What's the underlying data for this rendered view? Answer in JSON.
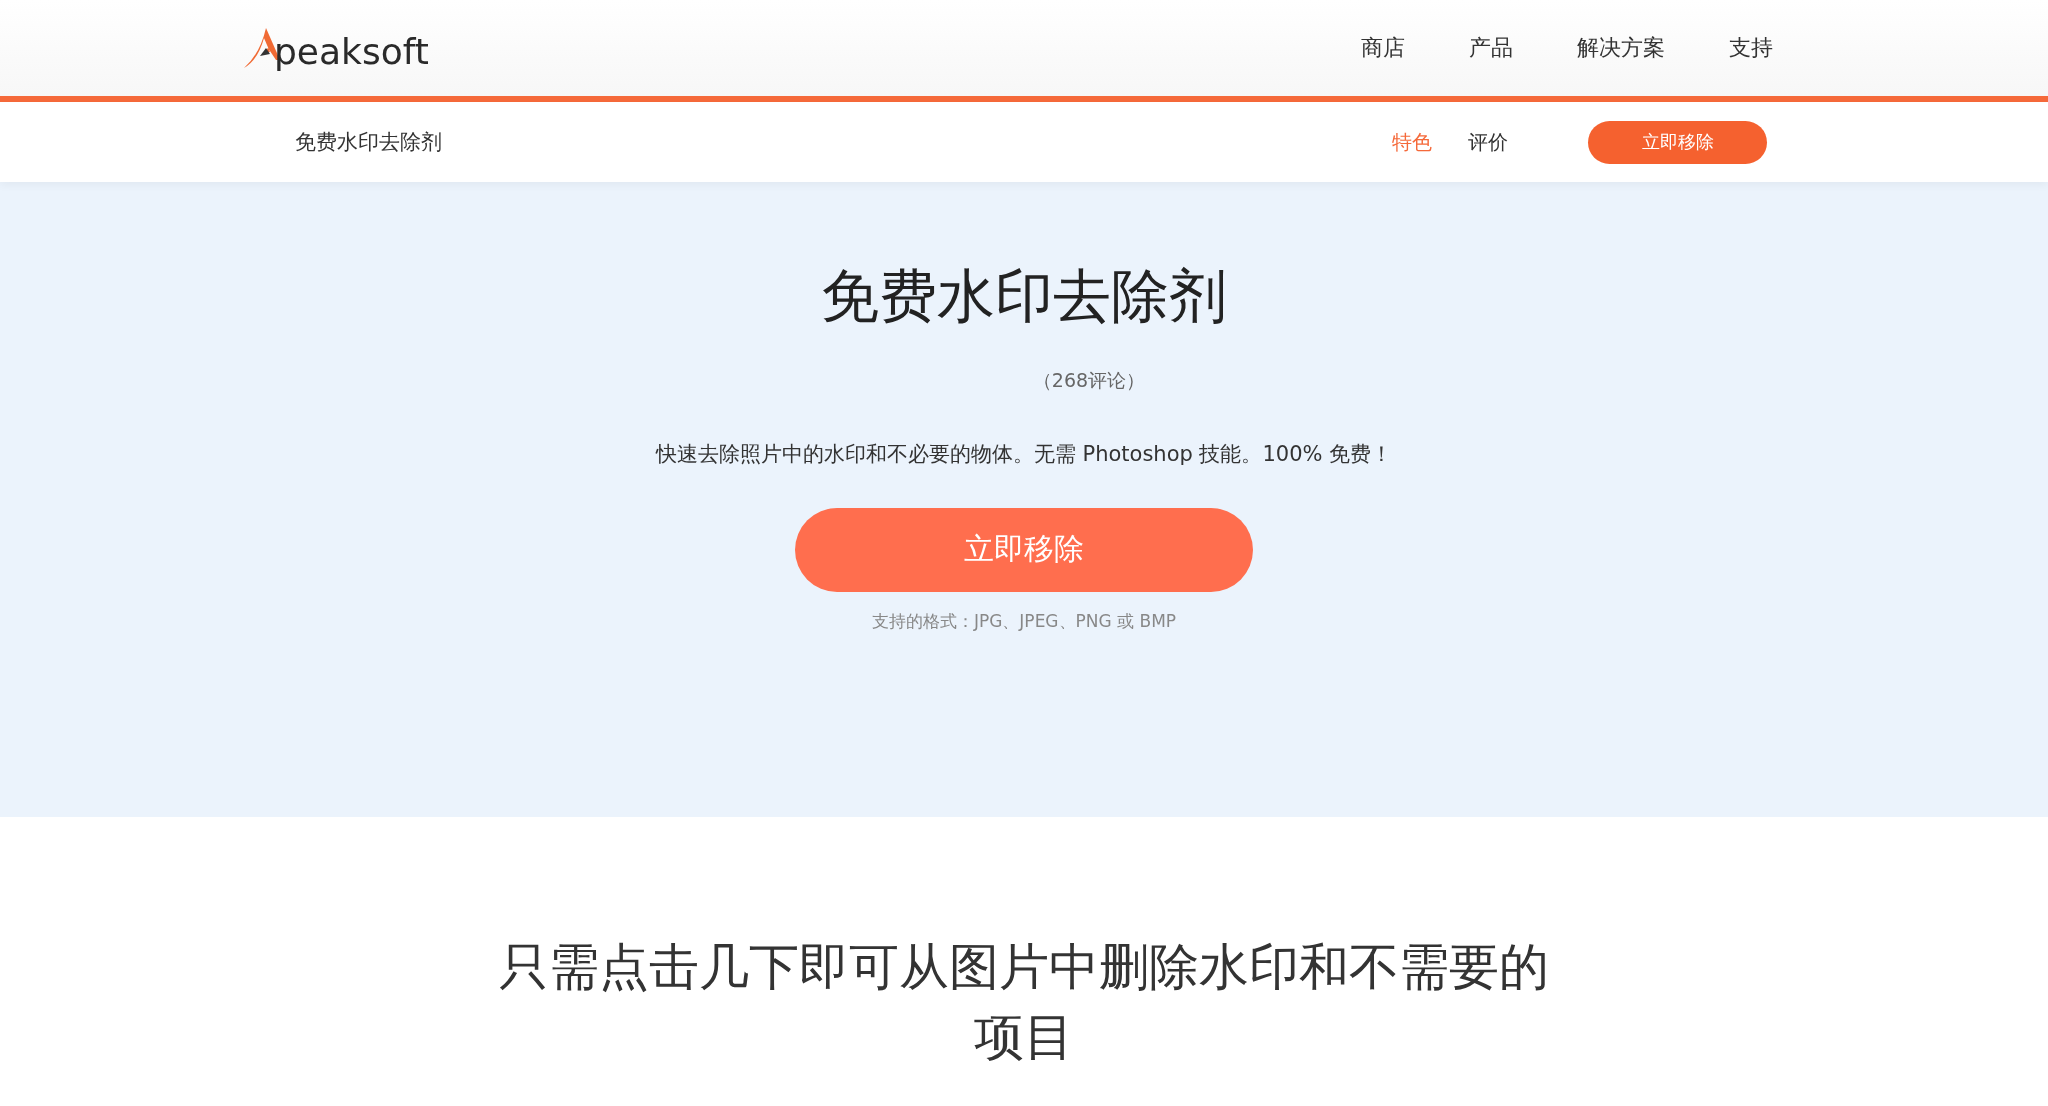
{
  "header": {
    "logo": "peaksoft",
    "nav": [
      {
        "label": "商店"
      },
      {
        "label": "产品"
      },
      {
        "label": "解决方案"
      },
      {
        "label": "支持"
      }
    ]
  },
  "subnav": {
    "title": "免费水印去除剂",
    "tabs": [
      {
        "label": "特色",
        "selected": true
      },
      {
        "label": "评价",
        "selected": false
      }
    ],
    "button": "立即移除"
  },
  "hero": {
    "title": "免费水印去除剂",
    "reviews": "（268评论）",
    "description": "快速去除照片中的水印和不必要的物体。无需 Photoshop 技能。100% 免费！",
    "button": "立即移除",
    "formats": "支持的格式：JPG、JPEG、PNG 或 BMP"
  },
  "section": {
    "heading": "只需点击几下即可从图片中删除水印和不需要的项目"
  }
}
